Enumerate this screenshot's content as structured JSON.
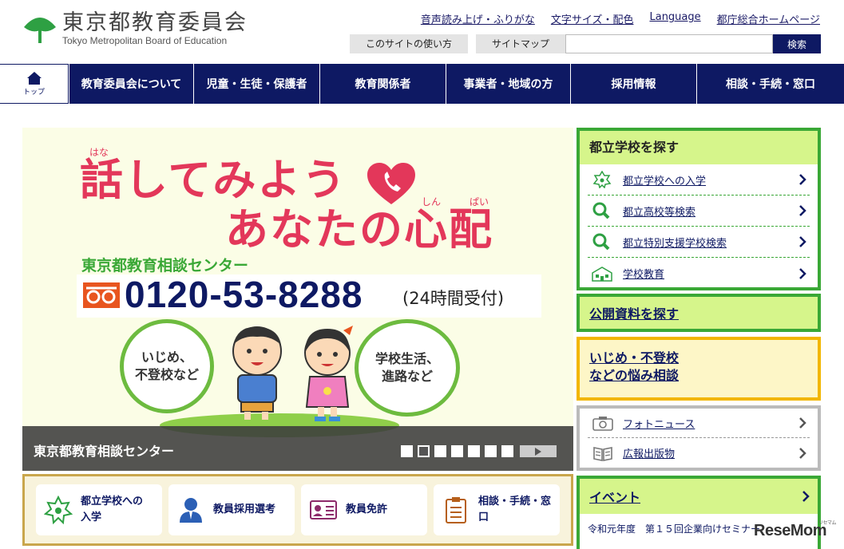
{
  "header": {
    "logo_jp": "東京都教育委員会",
    "logo_en": "Tokyo Metropolitan Board of Education",
    "util_links": [
      "音声読み上げ・ふりがな",
      "文字サイズ・配色",
      "Language",
      "都庁総合ホームページ"
    ],
    "sub_buttons": [
      "このサイトの使い方",
      "サイトマップ"
    ],
    "search_value": "",
    "search_button": "検索",
    "brand_color": "#0e1963"
  },
  "nav": {
    "home_label": "トップ",
    "items": [
      "教育委員会について",
      "児童・生徒・保護者",
      "教育関係者",
      "事業者・地域の方",
      "採用情報",
      "相談・手続・窓口"
    ]
  },
  "hero": {
    "ruby_hana": "はな",
    "line1": "話してみよう",
    "line2": "あなたの心配",
    "ruby_shinpai_1": "しん",
    "ruby_shinpai_2": "ぱい",
    "center_name": "東京都教育相談センター",
    "phone": "0120-53-8288",
    "phone_note": "(24時間受付)",
    "bubble_left": "いじめ、\n不登校など",
    "bubble_right": "学校生活、\n進路など",
    "caption": "東京都教育相談センター",
    "slide_count": 7,
    "active_slide": 2
  },
  "quick_buttons": [
    {
      "label": "都立学校への\n入学",
      "icon": "school-emblem-icon"
    },
    {
      "label": "教員採用選考",
      "icon": "teacher-icon"
    },
    {
      "label": "教員免許",
      "icon": "license-card-icon"
    },
    {
      "label": "相談・手続・窓口",
      "icon": "clipboard-icon"
    }
  ],
  "school_panel": {
    "title": "都立学校を探す",
    "items": [
      "都立学校への入学",
      "都立高校等検索",
      "都立特別支援学校検索",
      "学校教育"
    ]
  },
  "public_docs": {
    "label": "公開資料を探す"
  },
  "bullying": {
    "line1": "いじめ・不登校",
    "line2": "などの悩み相談"
  },
  "news_panel": {
    "items": [
      "フォトニュース",
      "広報出版物"
    ]
  },
  "event_panel": {
    "title": "イベント",
    "first_item": "令和元年度　第１５回企業向けセミナー"
  },
  "watermark": {
    "text": "ReseMom",
    "sub": "リセマム"
  }
}
